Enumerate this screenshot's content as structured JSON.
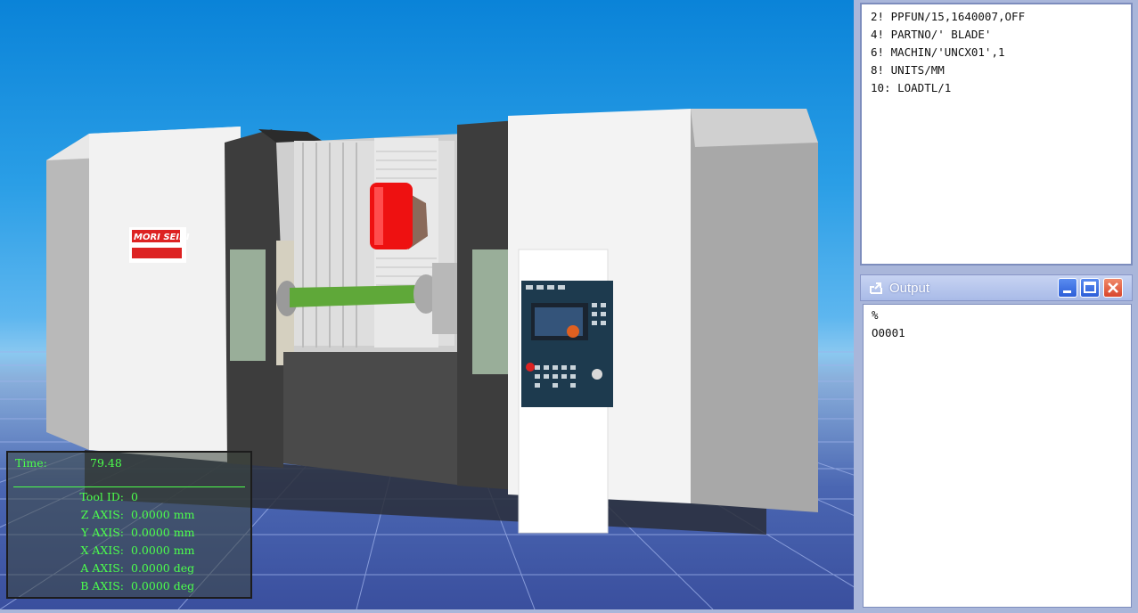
{
  "hud": {
    "time_label": "Time:",
    "time_value": "79.48",
    "rows": [
      {
        "label": "Tool ID:",
        "value": "0"
      },
      {
        "label": "Z AXIS:",
        "value": "0.0000 mm"
      },
      {
        "label": "Y AXIS:",
        "value": "0.0000 mm"
      },
      {
        "label": "X AXIS:",
        "value": "0.0000 mm"
      },
      {
        "label": "A AXIS:",
        "value": "0.0000 deg"
      },
      {
        "label": "B AXIS:",
        "value": "0.0000 deg"
      }
    ]
  },
  "machine": {
    "brand_text": "MORI SEIKI"
  },
  "code_panel": {
    "lines": [
      "2! PPFUN/15,1640007,OFF",
      "4! PARTNO/' BLADE'",
      "6! MACHIN/'UNCX01',1",
      "8! UNITS/MM",
      "10: LOADTL/1"
    ]
  },
  "output_panel": {
    "title": "Output",
    "icon": "output-icon",
    "lines": [
      "%",
      "O0001"
    ]
  },
  "colors": {
    "hud_text": "#4cff4c",
    "sky_top": "#0a83d8",
    "floor": "#4a66b2",
    "part": "#5fa839"
  }
}
